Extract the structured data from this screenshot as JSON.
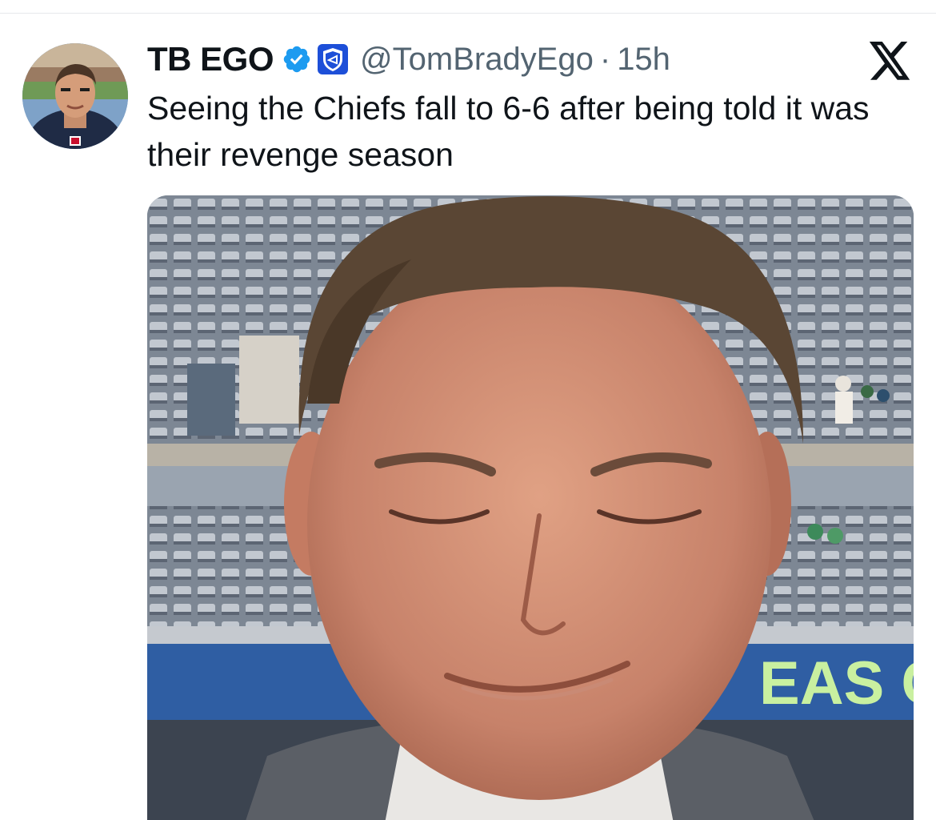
{
  "post": {
    "display_name": "TB EGO",
    "handle": "@TomBradyEgo",
    "separator": "·",
    "timestamp": "15h",
    "text": "Seeing the Chiefs fall to 6-6 after being told it was their revenge season"
  },
  "icons": {
    "verified": "verified-badge-icon",
    "affiliate": "affiliate-shield-icon",
    "platform": "x-logo-icon"
  },
  "media": {
    "banner_text": "EAS C"
  },
  "colors": {
    "verified_blue": "#1d9bf0",
    "text_primary": "#0f1419",
    "text_secondary": "#536471"
  }
}
